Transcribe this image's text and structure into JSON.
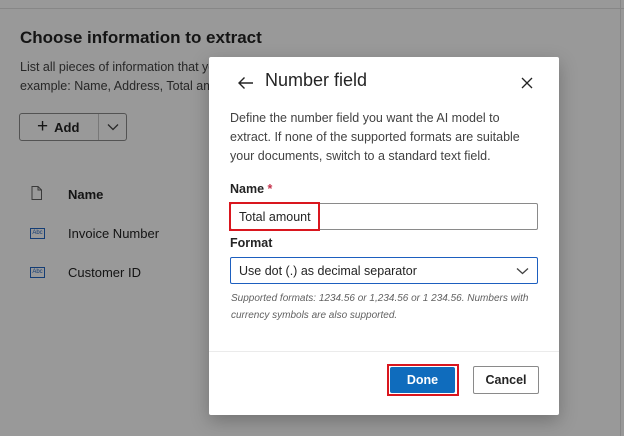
{
  "background": {
    "title": "Choose information to extract",
    "description_line1": "List all pieces of information that yo",
    "description_line2": "example: Name, Address, Total amo",
    "add_button_label": "Add",
    "table": {
      "column_name": "Name",
      "rows": [
        {
          "label": "Invoice Number",
          "icon_text": "Abc"
        },
        {
          "label": "Customer ID",
          "icon_text": "Abc"
        }
      ]
    }
  },
  "dialog": {
    "title": "Number field",
    "description": "Define the number field you want the AI model to extract. If none of the supported formats are suitable your documents, switch to a standard text field.",
    "name_label": "Name",
    "required_marker": "*",
    "name_value": "Total amount",
    "format_label": "Format",
    "format_value": "Use dot (.) as decimal separator",
    "helper_text": "Supported formats: 1234.56 or 1,234.56 or 1 234.56. Numbers with currency symbols are also supported.",
    "done_label": "Done",
    "cancel_label": "Cancel"
  },
  "colors": {
    "primary": "#0f6cbd",
    "highlight": "#d9161e",
    "required": "#c4314b",
    "overlay": "rgba(0,0,0,0.40)"
  },
  "icons": [
    "plus-icon",
    "chevron-down-icon",
    "document-icon",
    "text-field-icon",
    "back-arrow-icon",
    "close-icon"
  ]
}
